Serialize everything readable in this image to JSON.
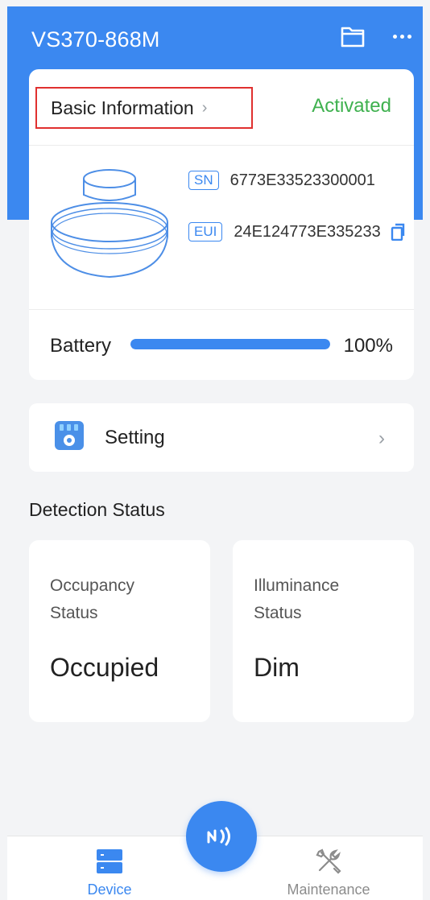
{
  "header": {
    "device_name": "VS370-868M"
  },
  "info_card": {
    "basic_info_label": "Basic Information",
    "status": "Activated",
    "sn": {
      "tag": "SN",
      "value": "6773E33523300001"
    },
    "eui": {
      "tag": "EUI",
      "value": "24E124773E335233"
    },
    "battery": {
      "label": "Battery",
      "level": 1.0,
      "text": "100%"
    }
  },
  "setting": {
    "label": "Setting"
  },
  "detection": {
    "title": "Detection Status",
    "cards": [
      {
        "label": "Occupancy Status",
        "value": "Occupied"
      },
      {
        "label": "Illuminance Status",
        "value": "Dim"
      }
    ]
  },
  "bottom_nav": {
    "items": [
      {
        "label": "Device",
        "icon": "device-icon",
        "active": true
      },
      {
        "label": "Maintenance",
        "icon": "tools-icon",
        "active": false
      }
    ],
    "fab_icon": "nfc-icon"
  },
  "colors": {
    "accent": "#3b88f0",
    "activated": "#3fb14f",
    "highlight_border": "#e0302f"
  }
}
